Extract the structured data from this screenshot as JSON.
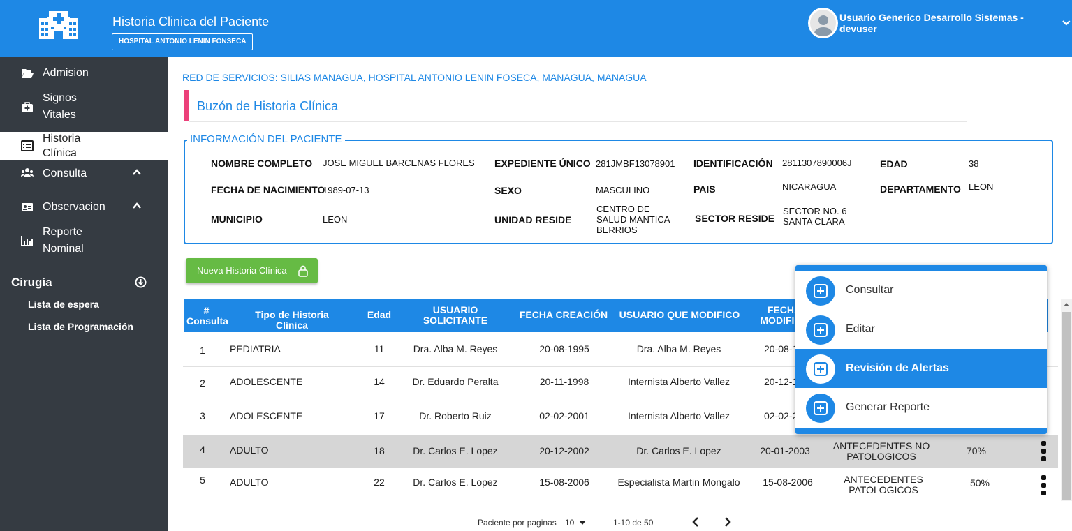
{
  "header": {
    "app_title": "Historia Clinica del Paciente",
    "hospital": "HOSPITAL ANTONIO LENIN FONSECA",
    "user_name": "Usuario Generico Desarrollo Sistemas - devuser",
    "brand_color": "#1e88e5"
  },
  "sidebar": {
    "items": [
      {
        "label": "Admision",
        "icon": "folder-open-icon"
      },
      {
        "label1": "Signos",
        "label2": "Vitales",
        "icon": "medical-kit-icon"
      },
      {
        "label1": "Historia",
        "label2": "Clínica",
        "icon": "list-icon",
        "active": true
      },
      {
        "label": "Consulta",
        "icon": "users-icon",
        "expandable": true
      },
      {
        "label": "Observacion",
        "icon": "id-card-icon",
        "expandable": true
      },
      {
        "label1": "Reporte",
        "label2": "Nominal",
        "icon": "bar-chart-icon"
      }
    ],
    "cirugia": {
      "title": "Cirugía",
      "items": [
        "Lista de espera",
        "Lista de Programación"
      ]
    }
  },
  "main": {
    "red_servicios": "RED DE SERVICIOS: SILIAS MANAGUA, HOSPITAL ANTONIO LENIN FOSECA, MANAGUA, MANAGUA",
    "page_title": "Buzón de Historia Clínica",
    "patient": {
      "legend": "INFORMACIÓN DEL PACIENTE",
      "nombre_label": "NOMBRE COMPLETO",
      "nombre": "JOSE MIGUEL BARCENAS FLORES",
      "expediente_label": "EXPEDIENTE ÚNICO",
      "expediente": "281JMBF13078901",
      "identificacion_label": "IDENTIFICACIÓN",
      "identificacion": "2811307890006J",
      "edad_label": "EDAD",
      "edad": "38",
      "fecha_label": "FECHA DE NACIMIENTO",
      "fecha": "1989-07-13",
      "sexo_label": "SEXO",
      "sexo": "MASCULINO",
      "pais_label": "PAIS",
      "pais": "NICARAGUA",
      "departamento_label": "DEPARTAMENTO",
      "departamento": "LEON",
      "municipio_label": "MUNICIPIO",
      "municipio": "LEON",
      "unidad_label": "UNIDAD RESIDE",
      "unidad_1": "CENTRO DE",
      "unidad_2": "SALUD MANTICA",
      "unidad_3": "BERRIOS",
      "sector_label": "SECTOR RESIDE",
      "sector_1": "SECTOR NO. 6",
      "sector_2": "SANTA CLARA"
    },
    "new_button": "Nueva Historia Clínica",
    "table": {
      "headers": {
        "num_1": "#",
        "num_2": "Consulta",
        "tipo": "Tipo de Historia Clínica",
        "edad": "Edad",
        "usuario_1": "USUARIO",
        "usuario_2": "SOLICITANTE",
        "fecha": "FECHA CREACIÓN",
        "modifico": "USUARIO QUE MODIFICO",
        "fecha_mod_1": "FECHA",
        "fecha_mod_2": "MODIFICA"
      },
      "rows": [
        {
          "num": "1",
          "tipo": "PEDIATRIA",
          "edad": "11",
          "solicitante": "Dra. Alba M. Reyes",
          "fecha": "20-08-1995",
          "modifico": "Dra. Alba M. Reyes",
          "fecha_mod": "20-08-1"
        },
        {
          "num": "2",
          "tipo": "ADOLESCENTE",
          "edad": "14",
          "solicitante": "Dr. Eduardo Peralta",
          "fecha": "20-11-1998",
          "modifico": "Internista Alberto Vallez",
          "fecha_mod": "20-12-1"
        },
        {
          "num": "3",
          "tipo": "ADOLESCENTE",
          "edad": "17",
          "solicitante": "Dr. Roberto Ruiz",
          "fecha": "02-02-2001",
          "modifico": "Internista Alberto Vallez",
          "fecha_mod": "02-02-20"
        },
        {
          "num": "4",
          "tipo": "ADULTO",
          "edad": "18",
          "solicitante": "Dr. Carlos E. Lopez",
          "fecha": "20-12-2002",
          "modifico": "Dr. Carlos E. Lopez",
          "fecha_mod": "20-01-2003",
          "estado_1": "ANTECEDENTES NO",
          "estado_2": "PATOLOGICOS",
          "avance": "70%"
        },
        {
          "num": "5",
          "tipo": "ADULTO",
          "edad": "22",
          "solicitante": "Dr. Carlos E. Lopez",
          "fecha": "15-08-2006",
          "modifico": "Especialista Martin Mongalo",
          "fecha_mod": "15-08-2006",
          "estado_1": "ANTECEDENTES",
          "estado_2": "PATOLOGICOS",
          "avance": "50%"
        }
      ]
    },
    "pagination": {
      "label": "Paciente por paginas",
      "per_page": "10",
      "range": "1-10 de  50"
    },
    "popup_menu": {
      "items": [
        {
          "label": "Consultar",
          "icon": "plus-square-icon"
        },
        {
          "label": "Editar",
          "icon": "plus-square-icon"
        },
        {
          "label": "Revisión de Alertas",
          "icon": "plus-square-icon",
          "selected": true
        },
        {
          "label": "Generar Reporte",
          "icon": "plus-square-icon"
        }
      ]
    }
  }
}
